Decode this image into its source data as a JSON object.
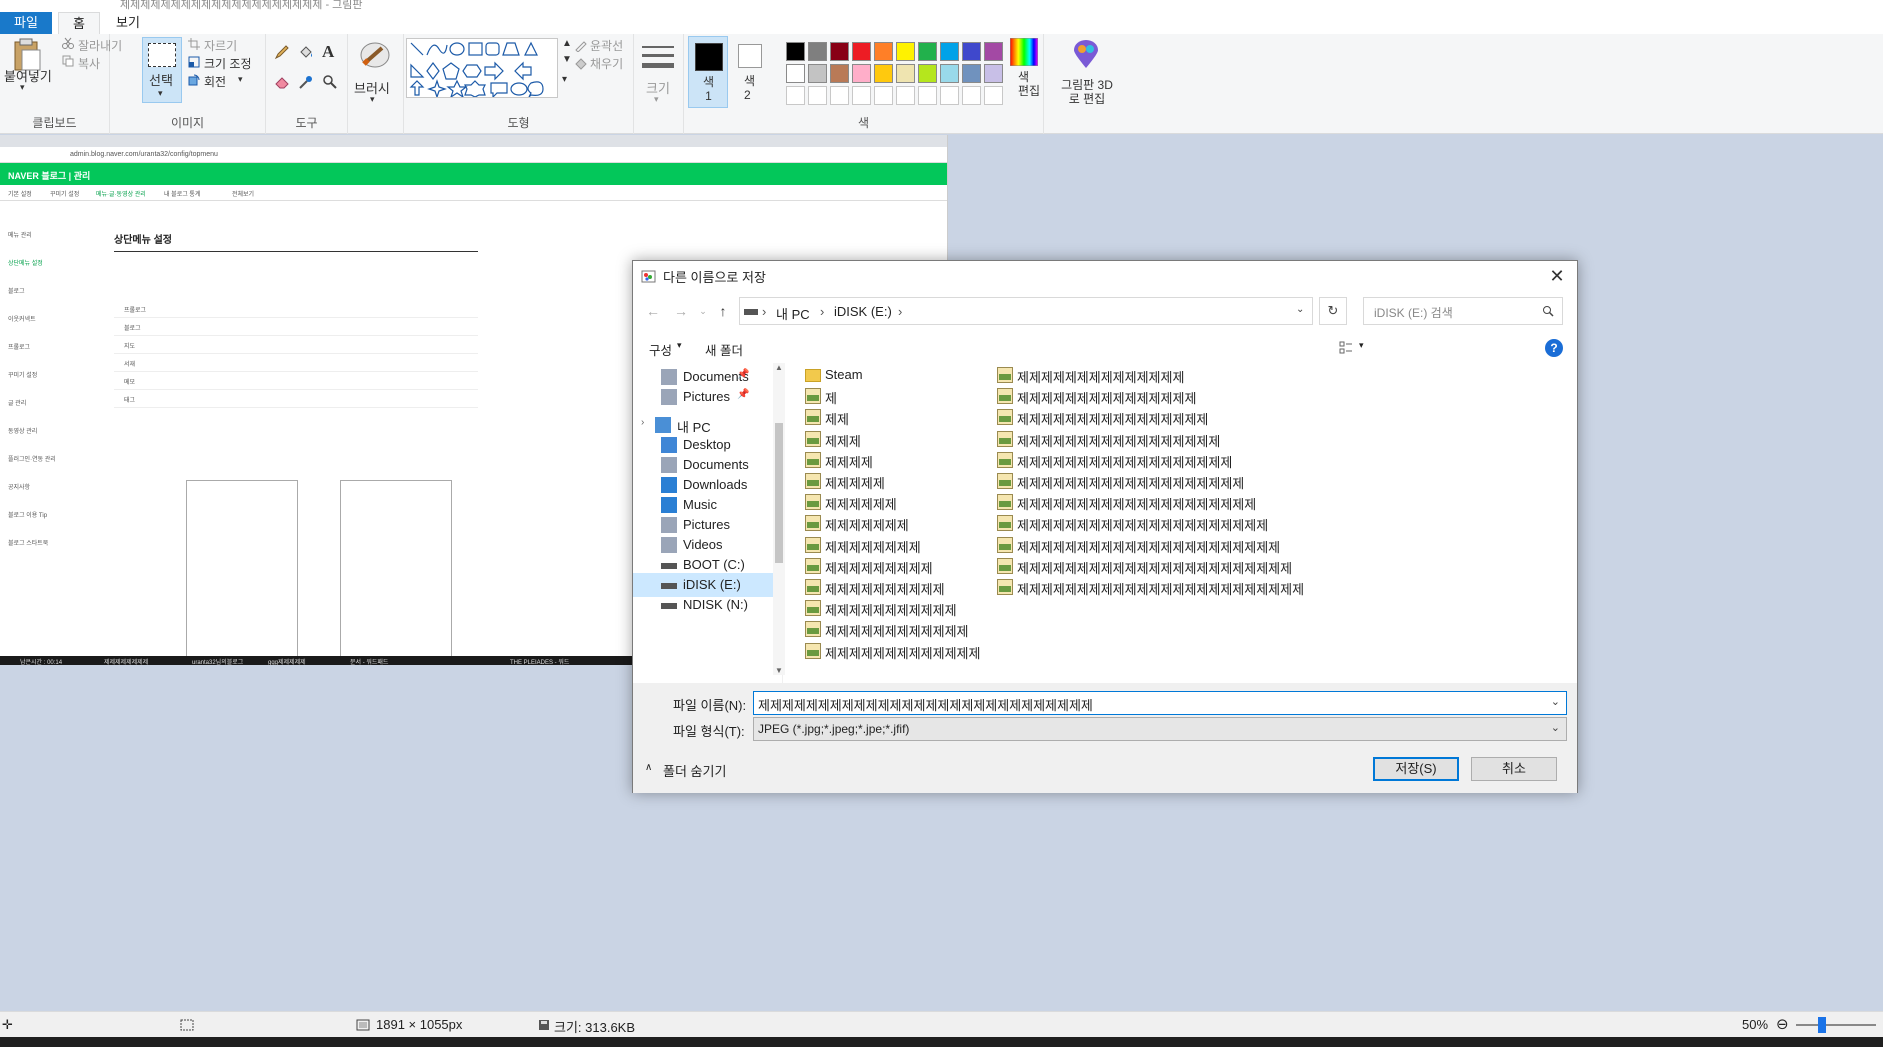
{
  "window": {
    "title": "제제제제제제제제제제제제제제제제제제제제 - 그림판"
  },
  "ribbon": {
    "tabs": [
      "파일",
      "홈",
      "보기"
    ],
    "clipboard": {
      "paste": "붙여넣기",
      "cut": "잘라내기",
      "copy": "복사",
      "label": "클립보드"
    },
    "image": {
      "select": "선택",
      "crop": "자르기",
      "resize": "크기 조정",
      "rotate": "회전",
      "label": "이미지"
    },
    "tools": {
      "label": "도구"
    },
    "brushes": {
      "label": "브러시"
    },
    "shapes": {
      "outline": "윤곽선",
      "fill": "채우기",
      "label": "도형"
    },
    "size": {
      "label": "크기"
    },
    "colors": {
      "color1": "색\n1",
      "color2": "색\n2",
      "edit": "색\n편집",
      "label": "색",
      "palette_row1": [
        "#000000",
        "#7f7f7f",
        "#880015",
        "#ed1c24",
        "#ff7f27",
        "#fff200",
        "#22b14c",
        "#00a2e8",
        "#3f48cc",
        "#a349a4"
      ],
      "palette_row2": [
        "#ffffff",
        "#c3c3c3",
        "#b97a57",
        "#ffaec9",
        "#ffc90e",
        "#efe4b0",
        "#b5e61d",
        "#99d9ea",
        "#7092be",
        "#c8bfe7"
      ]
    },
    "paint3d": "그림판 3D로 편집"
  },
  "dialog": {
    "title": "다른 이름으로 저장",
    "breadcrumb": [
      "내 PC",
      "iDISK (E:)"
    ],
    "search_placeholder": "iDISK (E:) 검색",
    "organize": "구성",
    "new_folder": "새 폴더",
    "nav": [
      "Documents",
      "Pictures",
      "내 PC",
      "Desktop",
      "Documents",
      "Downloads",
      "Music",
      "Pictures",
      "Videos",
      "BOOT (C:)",
      "iDISK (E:)",
      "NDISK (N:)"
    ],
    "files_col1": [
      "Steam",
      "제",
      "제제",
      "제제제",
      "제제제제",
      "제제제제제",
      "제제제제제제",
      "제제제제제제제",
      "제제제제제제제제",
      "제제제제제제제제제",
      "제제제제제제제제제제",
      "제제제제제제제제제제제",
      "제제제제제제제제제제제제",
      "제제제제제제제제제제제제제"
    ],
    "files_col2": [
      "제제제제제제제제제제제제제제",
      "제제제제제제제제제제제제제제제",
      "제제제제제제제제제제제제제제제제",
      "제제제제제제제제제제제제제제제제제",
      "제제제제제제제제제제제제제제제제제제",
      "제제제제제제제제제제제제제제제제제제제",
      "제제제제제제제제제제제제제제제제제제제제",
      "제제제제제제제제제제제제제제제제제제제제제",
      "제제제제제제제제제제제제제제제제제제제제제제",
      "제제제제제제제제제제제제제제제제제제제제제제제",
      "제제제제제제제제제제제제제제제제제제제제제제제제"
    ],
    "filename_label": "파일 이름(N):",
    "filename_value": "제제제제제제제제제제제제제제제제제제제제제제제제제제제제",
    "filetype_label": "파일 형식(T):",
    "filetype_value": "JPEG (*.jpg;*.jpeg;*.jpe;*.jfif)",
    "hide_folders": "폴더 숨기기",
    "save": "저장(S)",
    "cancel": "취소"
  },
  "status": {
    "dimensions": "1891 × 1055px",
    "size": "크기: 313.6KB",
    "zoom": "50%"
  },
  "pasted": {
    "url": "admin.blog.naver.com/uranta32/config/topmenu",
    "brand": "NAVER 블로그 | 관리",
    "page_title": "상단메뉴 설정",
    "sidebar": [
      "메뉴 관리",
      "상단메뉴 설정",
      "블로그",
      "이웃커넥트",
      "프롤로그",
      "꾸미기 설정",
      "글 관리",
      "동영상 관리",
      "플러그인·연동 관리",
      "공지사항",
      "블로그 이용 Tip",
      "블로그 스타트북"
    ],
    "top_links": [
      "기본 설정",
      "꾸미기 설정",
      "메뉴·글·동영상 관리",
      "내 블로그 통계",
      "전체보기"
    ],
    "table_rows": [
      "프롤로그",
      "블로그",
      "지도",
      "서재",
      "메모",
      "태그"
    ],
    "taskbar": [
      "남은시간 : 00:14",
      "제제제제제제제제",
      "uranta32님의블로그",
      "ggg제제제제제",
      "문서 - 워드패드",
      "THE PLEIADES - 워드"
    ]
  }
}
